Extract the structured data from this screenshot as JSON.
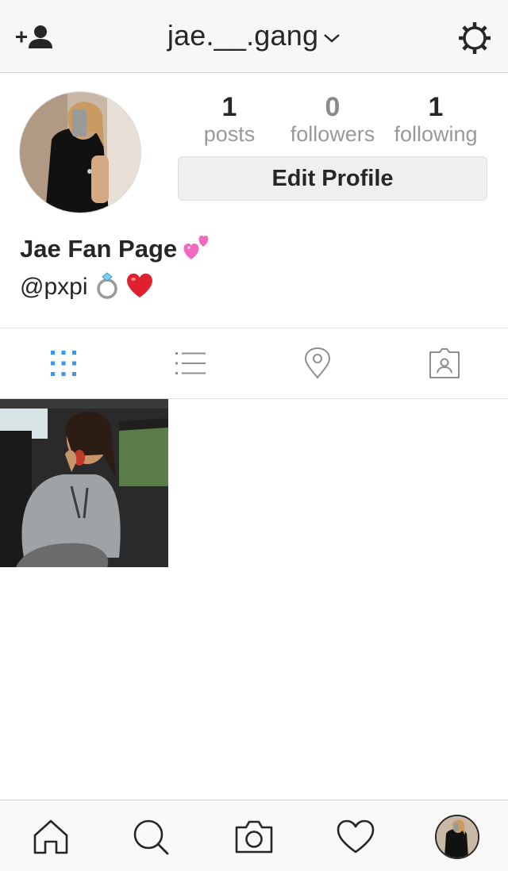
{
  "header": {
    "username": "jae.__.gang",
    "add_user_icon": "add-person-icon",
    "settings_icon": "gear-icon",
    "dropdown_icon": "chevron-down-icon"
  },
  "profile": {
    "stats": [
      {
        "value": "1",
        "label": "posts"
      },
      {
        "value": "0",
        "label": "followers"
      },
      {
        "value": "1",
        "label": "following"
      }
    ],
    "edit_button_label": "Edit Profile",
    "display_name": "Jae Fan Page",
    "bio_handle": "@pxpi"
  },
  "view_tabs": [
    {
      "name": "grid",
      "icon": "grid-icon",
      "active": true
    },
    {
      "name": "list",
      "icon": "list-icon",
      "active": false
    },
    {
      "name": "places",
      "icon": "location-pin-icon",
      "active": false
    },
    {
      "name": "tagged",
      "icon": "tagged-person-icon",
      "active": false
    }
  ],
  "bottom_nav": [
    {
      "name": "home",
      "icon": "home-icon"
    },
    {
      "name": "search",
      "icon": "search-icon"
    },
    {
      "name": "camera",
      "icon": "camera-icon"
    },
    {
      "name": "activity",
      "icon": "heart-icon"
    },
    {
      "name": "profile",
      "icon": "avatar"
    }
  ],
  "colors": {
    "active_tab": "#3897f0",
    "icon": "#262626",
    "muted_text": "#999999",
    "button_bg": "#efefef"
  }
}
